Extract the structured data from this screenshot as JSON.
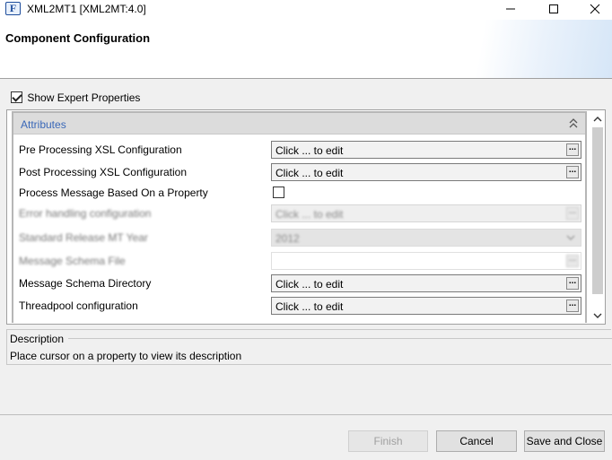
{
  "window": {
    "icon_letter": "F",
    "title": "XML2MT1 [XML2MT:4.0]"
  },
  "header": {
    "title": "Component Configuration"
  },
  "expert": {
    "label": "Show Expert Properties",
    "checked": true
  },
  "section": {
    "label": "Attributes"
  },
  "properties": [
    {
      "name": "Pre Processing XSL Configuration",
      "value": "Click ... to edit",
      "type": "editor",
      "enabled": true
    },
    {
      "name": "Post Processing XSL Configuration",
      "value": "Click ... to edit",
      "type": "editor",
      "enabled": true
    },
    {
      "name": "Process Message Based On a Property",
      "value": "",
      "type": "checkbox",
      "enabled": true,
      "checked": false
    },
    {
      "name": "Error handling configuration",
      "value": "Click ... to edit",
      "type": "editor",
      "enabled": false
    },
    {
      "name": "Standard Release MT Year",
      "value": "2012",
      "type": "select",
      "enabled": false
    },
    {
      "name": "Message Schema File",
      "value": "",
      "type": "editor",
      "enabled": false
    },
    {
      "name": "Message Schema Directory",
      "value": "Click ... to edit",
      "type": "editor",
      "enabled": true
    },
    {
      "name": "Threadpool configuration",
      "value": "Click ... to edit",
      "type": "editor",
      "enabled": true
    }
  ],
  "ellipsis_label": "...",
  "description": {
    "title": "Description",
    "text": "Place cursor on a property to view its description"
  },
  "buttons": {
    "finish": "Finish",
    "cancel": "Cancel",
    "save_close": "Save and Close"
  },
  "colors": {
    "section_label": "#3a68b8",
    "section_background": "#dcdcdc"
  }
}
